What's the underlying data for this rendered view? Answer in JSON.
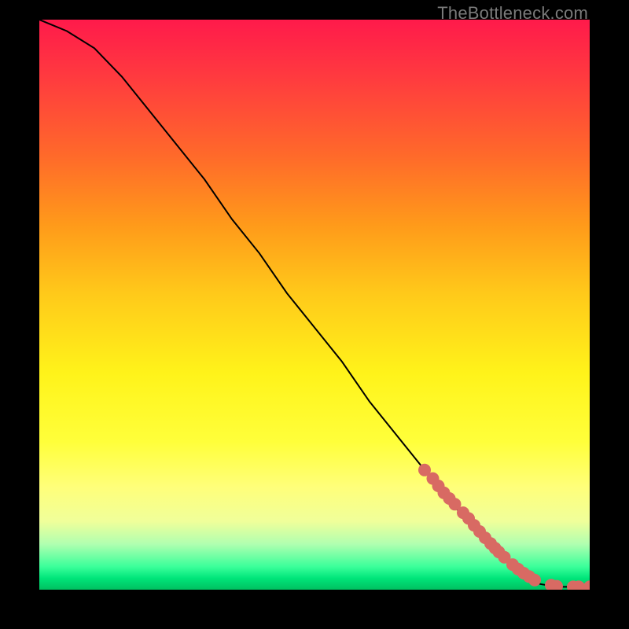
{
  "watermark": "TheBottleneck.com",
  "colors": {
    "dot": "#d86a63",
    "line": "#000000"
  },
  "chart_data": {
    "type": "line",
    "title": "",
    "xlabel": "",
    "ylabel": "",
    "xlim": [
      0,
      100
    ],
    "ylim": [
      0,
      100
    ],
    "grid": false,
    "series": [
      {
        "name": "curve",
        "x": [
          0,
          5,
          10,
          15,
          20,
          25,
          30,
          35,
          40,
          45,
          50,
          55,
          60,
          65,
          70,
          75,
          80,
          85,
          88,
          91,
          94,
          97,
          100
        ],
        "y": [
          100,
          98,
          95,
          90,
          84,
          78,
          72,
          65,
          59,
          52,
          46,
          40,
          33,
          27,
          21,
          15,
          10,
          5,
          2.5,
          1,
          0.5,
          0.5,
          0.5
        ]
      },
      {
        "name": "dots",
        "x": [
          70,
          71.5,
          72.5,
          73.5,
          74.5,
          75.5,
          77,
          78,
          79,
          80,
          81,
          82,
          82.8,
          83.5,
          84.5,
          86,
          87,
          88,
          89,
          90,
          93,
          94,
          97,
          98,
          100
        ],
        "y": [
          21,
          19.5,
          18.2,
          17,
          16,
          15,
          13.5,
          12.5,
          11.3,
          10.2,
          9.1,
          8.1,
          7.3,
          6.6,
          5.7,
          4.4,
          3.6,
          2.9,
          2.3,
          1.7,
          0.8,
          0.6,
          0.5,
          0.5,
          0.5
        ]
      }
    ]
  }
}
